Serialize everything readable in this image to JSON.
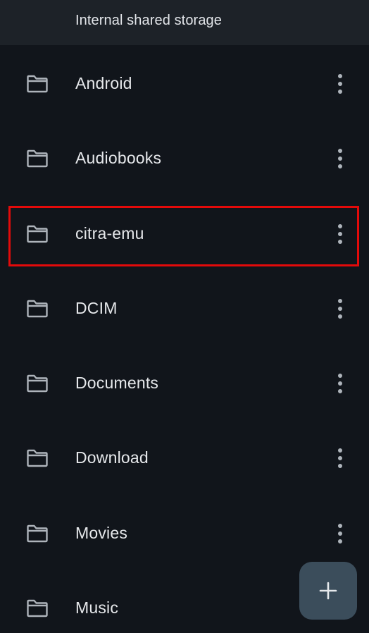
{
  "header": {
    "title": "Internal shared storage"
  },
  "folders": [
    {
      "name": "Android",
      "icon": "folder-icon"
    },
    {
      "name": "Audiobooks",
      "icon": "folder-icon"
    },
    {
      "name": "citra-emu",
      "icon": "folder-icon",
      "highlighted": true
    },
    {
      "name": "DCIM",
      "icon": "folder-icon"
    },
    {
      "name": "Documents",
      "icon": "folder-icon"
    },
    {
      "name": "Download",
      "icon": "folder-icon"
    },
    {
      "name": "Movies",
      "icon": "folder-icon"
    },
    {
      "name": "Music",
      "icon": "folder-icon"
    }
  ],
  "fab": {
    "icon": "plus-icon"
  },
  "colors": {
    "background": "#11151b",
    "header": "#1d2228",
    "text": "#e6e8eb",
    "icon": "#aeb4bb",
    "highlight": "#e30a0a",
    "fab": "#3b4d5b"
  }
}
